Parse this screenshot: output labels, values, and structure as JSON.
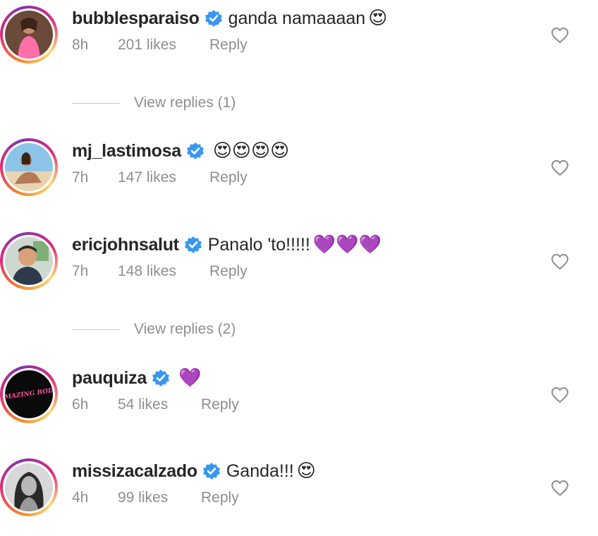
{
  "colors": {
    "verified": "#3897f0",
    "meta": "#8e8e8e",
    "text": "#262626"
  },
  "comments": [
    {
      "username": "bubblesparaiso",
      "text": "ganda namaaaan",
      "emoji": "😍",
      "time": "8h",
      "likes": "201 likes",
      "reply": "Reply",
      "avatar": "bubbles-avatar"
    },
    {
      "username": "mj_lastimosa",
      "text": "",
      "emoji": "😍😍😍😍",
      "time": "7h",
      "likes": "147 likes",
      "reply": "Reply",
      "avatar": "mj-avatar"
    },
    {
      "username": "ericjohnsalut",
      "text": "Panalo 'to!!!!!",
      "emoji": "💜💜💜",
      "time": "7h",
      "likes": "148 likes",
      "reply": "Reply",
      "avatar": "eric-avatar"
    },
    {
      "username": "pauquiza",
      "text": "",
      "emoji": "💜",
      "time": "6h",
      "likes": "54 likes",
      "reply": "Reply",
      "avatar": "pau-avatar",
      "avatar_text": "AMAZING BODY"
    },
    {
      "username": "missizacalzado",
      "text": "Ganda!!!",
      "emoji": "😍",
      "time": "4h",
      "likes": "99 likes",
      "reply": "Reply",
      "avatar": "iza-avatar"
    }
  ],
  "view_replies": [
    {
      "label": "View replies (1)"
    },
    {
      "label": "View replies (2)"
    }
  ]
}
